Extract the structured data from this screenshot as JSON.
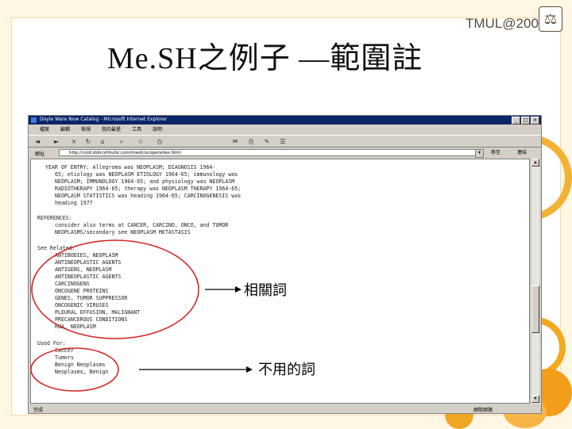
{
  "slide": {
    "title": "Me.SH之例子 —範圍註",
    "logo": {
      "text": "TMUL@2006",
      "badge_glyph": "⚖"
    }
  },
  "browser": {
    "title": "Doyle Ware Now Catalog - Microsoft Internet Explorer",
    "window_buttons": [
      "_",
      "□",
      "×"
    ],
    "menu": [
      "檔案",
      "編輯",
      "檢視",
      "我的最愛",
      "工具",
      "說明"
    ],
    "address_label": "網址",
    "address_value": "http://cold.dohcshhuhz.com/mesh/scopenotes.html",
    "go_label": "移至",
    "links_label": "連結",
    "status_left": "完成",
    "status_zone": "網際網路"
  },
  "content": {
    "block1": [
      "YEAR OF ENTRY: Allegroma was NEOPLASM; DIAGNOSIS 1964-",
      "65; etiology was NEOPLASM ETIOLOGY 1964-65; immunology was",
      "NEOPLASM; IMMUNOLOGY 1964-65; and physiology was NEOPLASM",
      "RADIOTHERAPY 1964-65; therapy was NEOPLASM THERAPY 1964-65;",
      "NEOPLASM STATISTICS was heading 1964-65; CARCINOGENESIS was",
      "heading 1977"
    ],
    "references_heading": "REFERENCES:",
    "references": [
      "consider also terms at CANCER, CARCINO, ONCO, and TUMOR",
      "NEOPLASMS/secondary see NEOPLASM METASTASIS"
    ],
    "see_related_heading": "See Related:",
    "see_related": [
      "ANTIBODIES, NEOPLASM",
      "ANTINEOPLASTIC AGENTS",
      "ANTIGENS, NEOPLASM",
      "ANTINEOPLASTIC AGENTS",
      "CARCINOGENS",
      "ONCOGENE PROTEINS",
      "GENES, TUMOR SUPPRESSOR",
      "ONCOGENIC VIRUSES",
      "PLEURAL EFFUSION, MALIGNANT",
      "PRECANCEROUS CONDITIONS",
      "RNA, NEOPLASM"
    ],
    "used_for_heading": "Used For:",
    "used_for": [
      "Cancer",
      "Tumors",
      "Benign Neoplasms",
      "Neoplasms, Benign"
    ]
  },
  "annotations": {
    "related_label": "相關詞",
    "unused_label": "不用的詞",
    "circle_color": "#d62828"
  },
  "colors": {
    "accent_orange": "#f2a91e",
    "titlebar": "#0a246a"
  }
}
